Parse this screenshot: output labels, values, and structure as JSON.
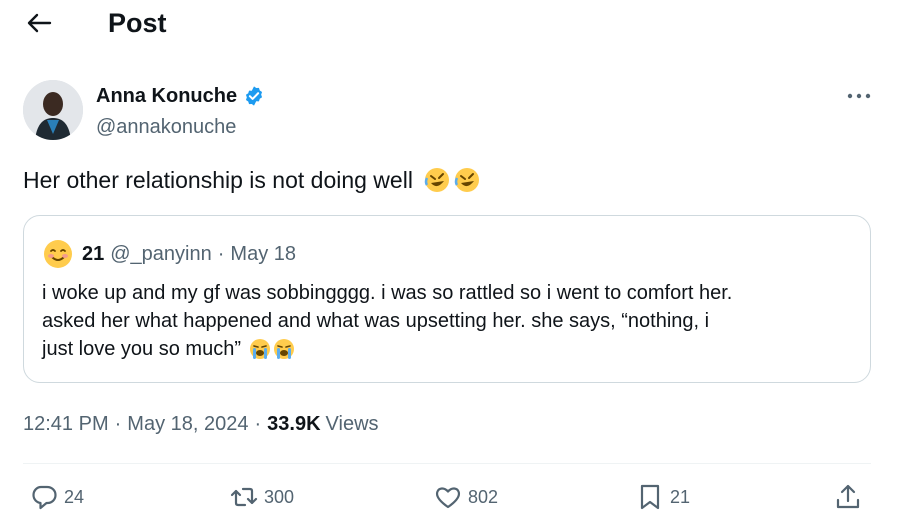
{
  "header": {
    "title": "Post",
    "back_icon": "arrow-left-icon"
  },
  "author": {
    "name": "Anna Konuche",
    "handle": "@annakonuche",
    "verified": true,
    "verified_color": "#1d9bf0"
  },
  "post": {
    "text": "Her other relationship is not doing well",
    "emojis": [
      "rolling-on-floor-laughing-emoji",
      "rolling-on-floor-laughing-emoji"
    ]
  },
  "quoted": {
    "avatar_icon": "smiling-face-emoji",
    "name": "21",
    "handle": "@_panyinn",
    "separator": "·",
    "date": "May 18",
    "lines": [
      "i woke up and my gf was sobbingggg. i was so rattled so i went to comfort her.",
      "asked her what happened and what was upsetting her. she says, “nothing, i",
      "just love you so much”"
    ],
    "trailing_emojis": [
      "loudly-crying-face-emoji",
      "loudly-crying-face-emoji"
    ]
  },
  "meta": {
    "time": "12:41 PM",
    "sep1": "·",
    "date": "May 18, 2024",
    "sep2": "·",
    "views_count": "33.9K",
    "views_label": "Views"
  },
  "actions": {
    "replies": "24",
    "reposts": "300",
    "likes": "802",
    "bookmarks": "21"
  },
  "colors": {
    "text": "#0f1419",
    "secondary": "#536471",
    "border": "#cfd9de",
    "accent": "#1d9bf0"
  }
}
